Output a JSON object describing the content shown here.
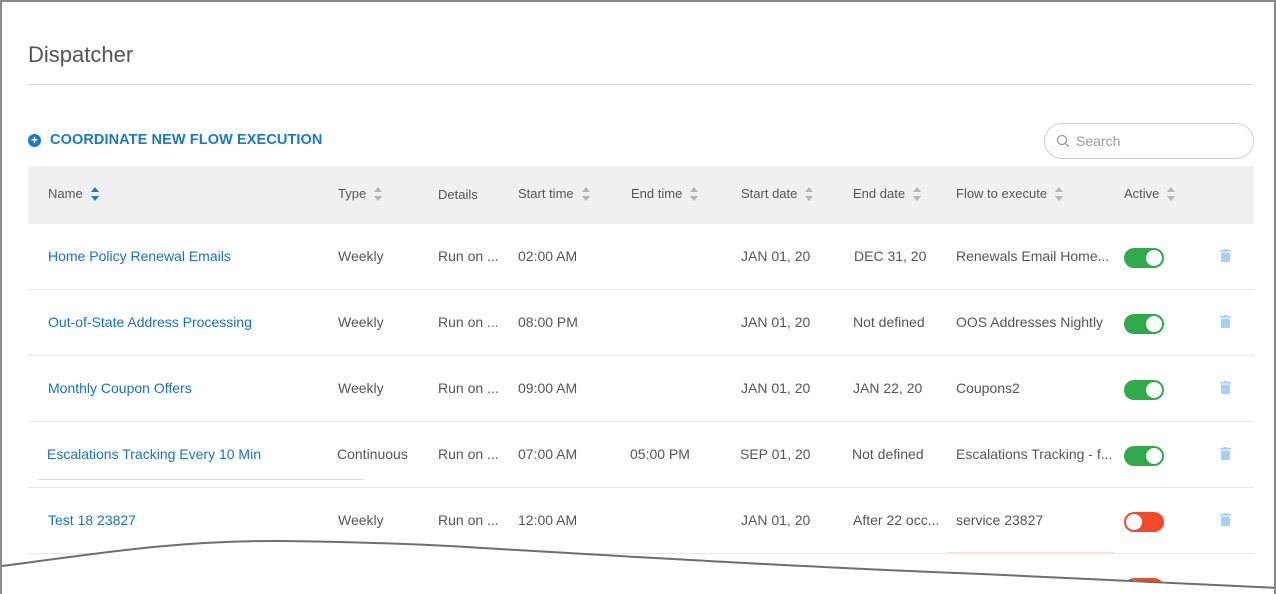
{
  "page": {
    "title": "Dispatcher"
  },
  "actions": {
    "add_label": "COORDINATE NEW FLOW EXECUTION",
    "add_icon": "plus-circle-icon"
  },
  "search": {
    "placeholder": "Search",
    "value": "",
    "icon": "search-icon"
  },
  "colors": {
    "accent": "#1a7ac2",
    "active_on": "#2faa4a",
    "active_off": "#f04a2a",
    "header_bg": "#f0f0f0"
  },
  "table": {
    "columns": [
      "Name",
      "Type",
      "Details",
      "Start time",
      "End time",
      "Start date",
      "End date",
      "Flow to execute",
      "Active"
    ],
    "sorted_column": "Name",
    "sort_direction": "ascending",
    "rows": [
      {
        "name": "Home Policy Renewal Emails",
        "type": "Weekly",
        "details": "Run on ...",
        "start_time": "02:00 AM",
        "end_time": "",
        "start_date": "JAN 01, 20",
        "end_date": "DEC 31, 20",
        "flow": "Renewals Email Home...",
        "active": true
      },
      {
        "name": "Out-of-State Address Processing",
        "type": "Weekly",
        "details": "Run on ...",
        "start_time": "08:00 PM",
        "end_time": "",
        "start_date": "JAN 01, 20",
        "end_date": "Not defined",
        "flow": "OOS Addresses Nightly",
        "active": true
      },
      {
        "name": "Monthly Coupon Offers",
        "type": "Weekly",
        "details": "Run on ...",
        "start_time": "09:00 AM",
        "end_time": "",
        "start_date": "JAN 01, 20",
        "end_date": "JAN 22, 20",
        "flow": "Coupons2",
        "active": true
      },
      {
        "name": "Escalations Tracking Every 10 Min",
        "type": "Continuous",
        "details": "Run on ...",
        "start_time": "07:00 AM",
        "end_time": "05:00 PM",
        "start_date": "SEP 01, 20",
        "end_date": "Not defined",
        "flow": "Escalations Tracking - f...",
        "active": true
      },
      {
        "name": "Test 18 23827",
        "type": "Weekly",
        "details": "Run on ...",
        "start_time": "12:00 AM",
        "end_time": "",
        "start_date": "JAN 01, 20",
        "end_date": "After 22 occ...",
        "flow": "service 23827",
        "active": false
      }
    ]
  }
}
